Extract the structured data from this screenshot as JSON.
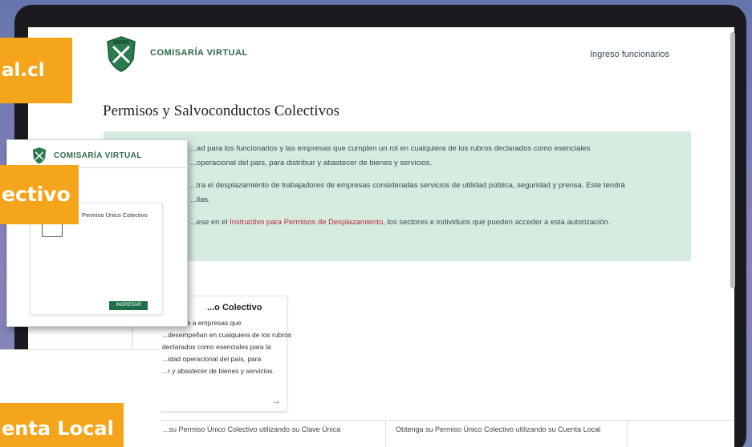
{
  "header": {
    "site_name": "COMISARÍA VIRTUAL",
    "staff_link": "Ingreso funcionarios"
  },
  "page_title": "Permisos y Salvoconductos Colectivos",
  "info": {
    "line1": "...ad para los funcionarios y las empresas que cumplen un rol en cualquiera de los rubros declarados como esenciales",
    "line2": "...operacional del país, para distribuir y abastecer de bienes y servicios.",
    "line3": "...tra el desplazamiento de trabajadores de empresas consideradas servicios de utilidad pública, seguridad y prensa. Este tendrá",
    "line4": "...llas.",
    "line5_pre": "...ese en el ",
    "line5_link": "Instructivo para Permisos de Desplazamiento",
    "line5_post": ", los sectores e individuos que pueden acceder a esta autorización."
  },
  "card": {
    "title": "...o Colectivo",
    "lines": [
      "...permite a empresas que",
      "...desempeñan en cualquiera de los rubros",
      "declarados como esenciales para la",
      "...idad operacional del país, para",
      "...r y abastecer de bienes y servicios."
    ]
  },
  "tabs": {
    "tab1": "...su Permiso Único Colectivo utilizando su Clave Única",
    "tab2": "Obtenga su Permiso Único Colectivo utilizando su Cuenta Local"
  },
  "overlay": {
    "site_name": "COMISARÍA VIRTUAL",
    "inner_title": "Permiso Único Colectivo",
    "go_label": "INGRESAR"
  },
  "tags": {
    "tag1": "al.cl",
    "tag2": "ectivo",
    "tag3": "enta Local"
  },
  "colors": {
    "brand_green": "#1f6e4a",
    "info_bg": "#d7ece1",
    "tag_orange": "#f5a51b"
  }
}
